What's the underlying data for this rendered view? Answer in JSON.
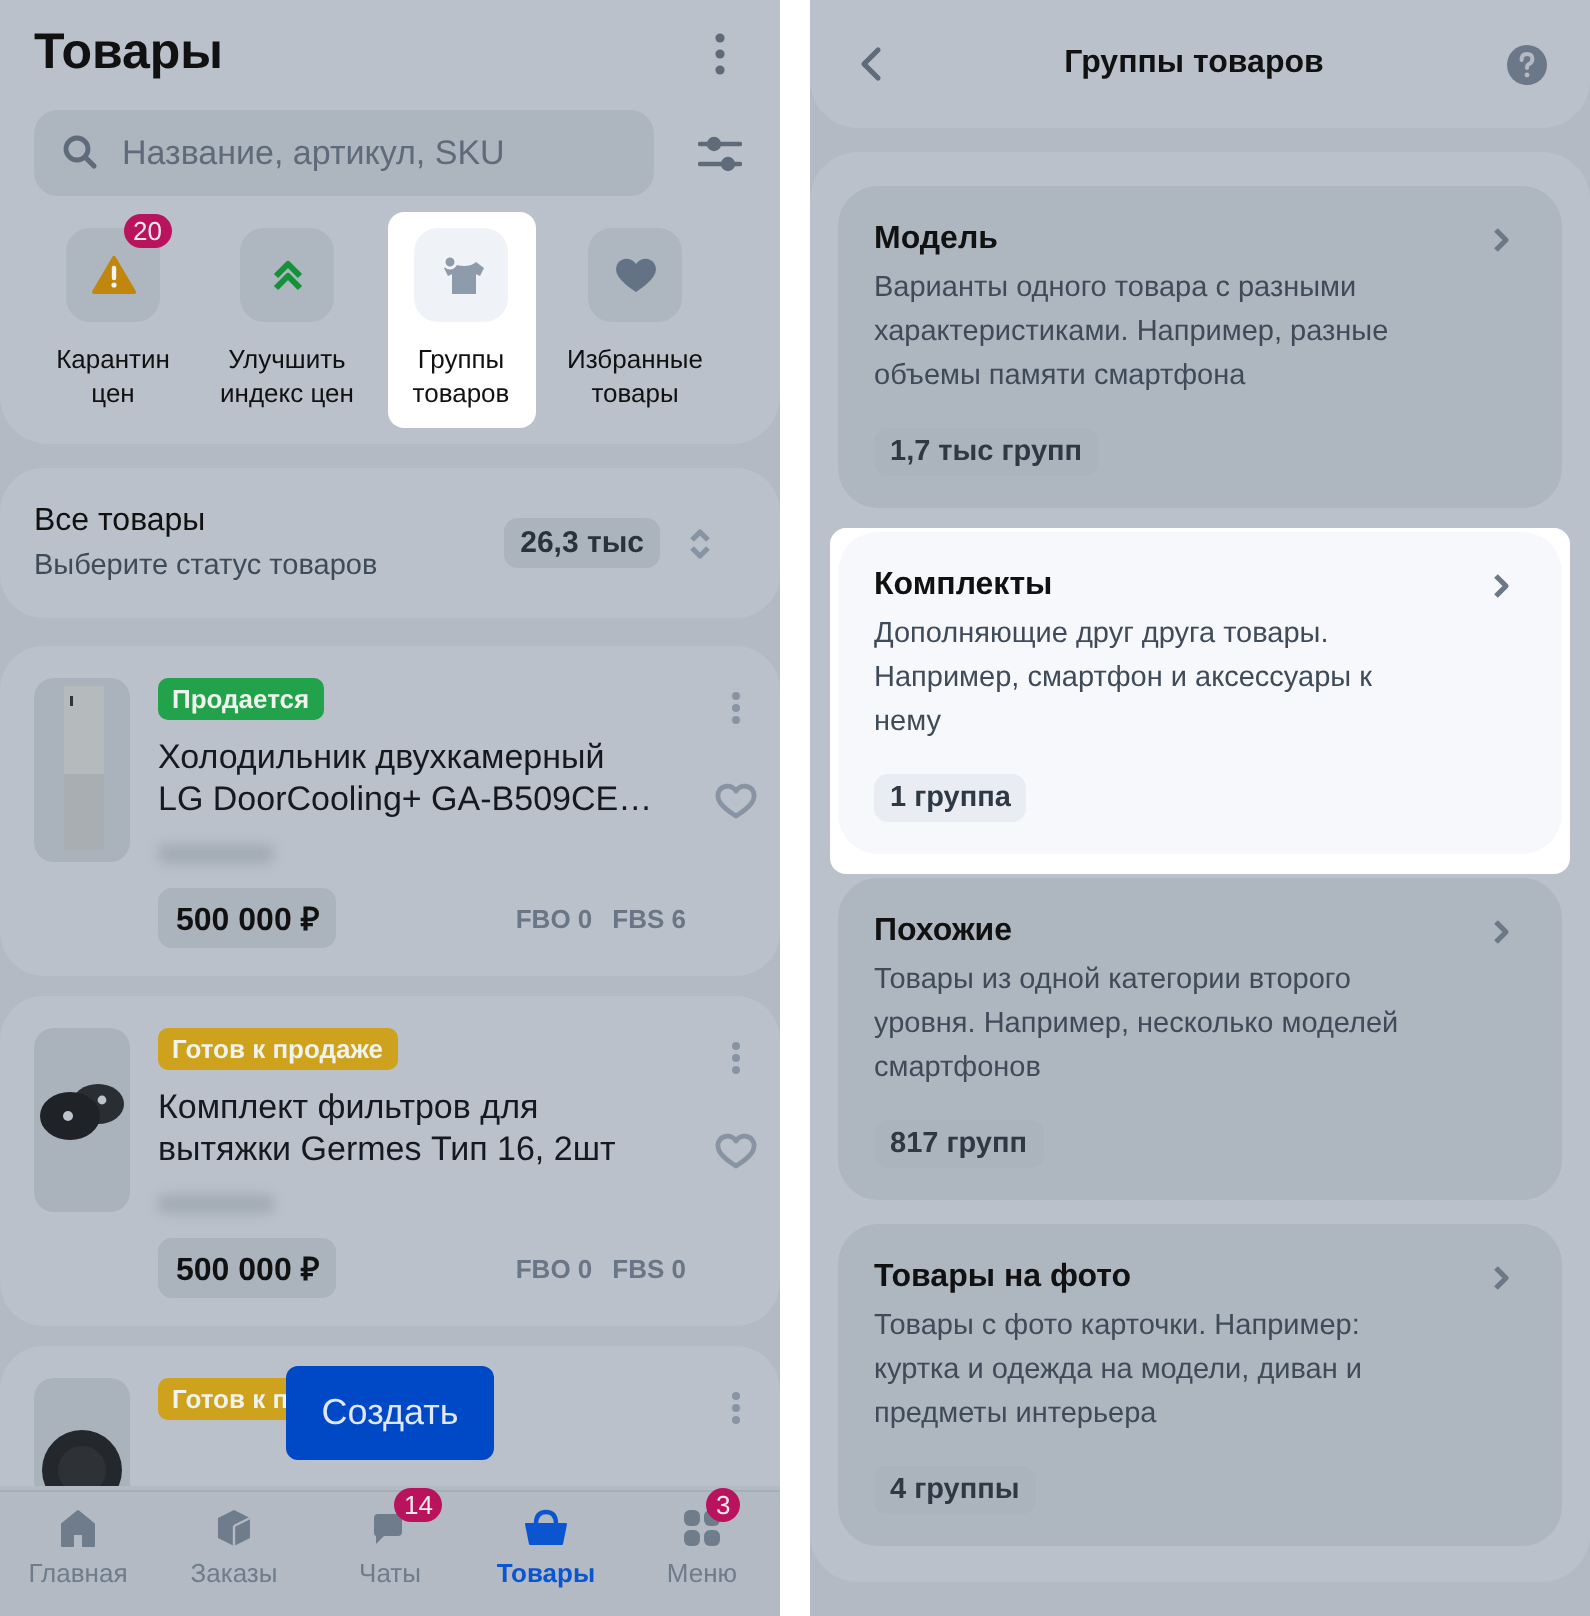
{
  "products_screen": {
    "title": "Товары",
    "search": {
      "placeholder": "Название, артикул, SKU"
    },
    "shortcuts": [
      {
        "kind": "warning",
        "label": "Карантин цен",
        "badge": "20",
        "highlighted": false
      },
      {
        "kind": "improve",
        "label": "Улучшить индекс цен",
        "highlighted": false
      },
      {
        "kind": "groups",
        "label": "Группы товаров",
        "highlighted": true
      },
      {
        "kind": "favorite",
        "label": "Избранные товары",
        "highlighted": false
      }
    ],
    "status_filter": {
      "title": "Все товары",
      "subtitle": "Выберите статус товаров",
      "count": "26,3 тыс"
    },
    "products": [
      {
        "kind": "fridge",
        "status": "Продается",
        "color": "#22a24a",
        "name": "Холодильник двухкамерный LG DoorCooling+ GA-B509CE…",
        "price": "500 000 ₽",
        "fbo": "FBO 0",
        "fbs": "FBS 6"
      },
      {
        "kind": "filters",
        "status": "Готов к продаже",
        "color": "#cfa21e",
        "name": "Комплект фильтров для вытяжки Germes Тип 16, 2шт",
        "price": "500 000 ₽",
        "fbo": "FBO 0",
        "fbs": "FBS 0"
      },
      {
        "kind": "filter",
        "status": "Готов к п",
        "color": "#cfa21e"
      }
    ],
    "create_button": "Создать",
    "nav": [
      {
        "kind": "home",
        "label": "Главная",
        "selected": false
      },
      {
        "kind": "orders",
        "label": "Заказы",
        "selected": false
      },
      {
        "kind": "chats",
        "label": "Чаты",
        "badge": "14",
        "selected": false
      },
      {
        "kind": "products",
        "label": "Товары",
        "selected": true
      },
      {
        "kind": "menu",
        "label": "Меню",
        "badge": "3",
        "selected": false
      }
    ]
  },
  "groups_screen": {
    "title": "Группы товаров",
    "groups": [
      {
        "title": "Модель",
        "description": "Варианты одного товара с разными характеристиками. Например, разные объемы памяти смартфона",
        "count": "1,7 тыс групп",
        "highlighted": false
      },
      {
        "title": "Комплекты",
        "description": "Дополняющие друг друга товары. Например, смартфон и аксессуары к нему",
        "count": "1 группа",
        "highlighted": true
      },
      {
        "title": "Похожие",
        "description": "Товары из одной категории второго уровня. Например, несколько моделей смартфонов",
        "count": "817 групп",
        "highlighted": false
      },
      {
        "title": "Товары на фото",
        "description": "Товары с фото карточки. Например: куртка и одежда на модели, диван и предметы интерьера",
        "count": "4 группы",
        "highlighted": false
      }
    ]
  }
}
